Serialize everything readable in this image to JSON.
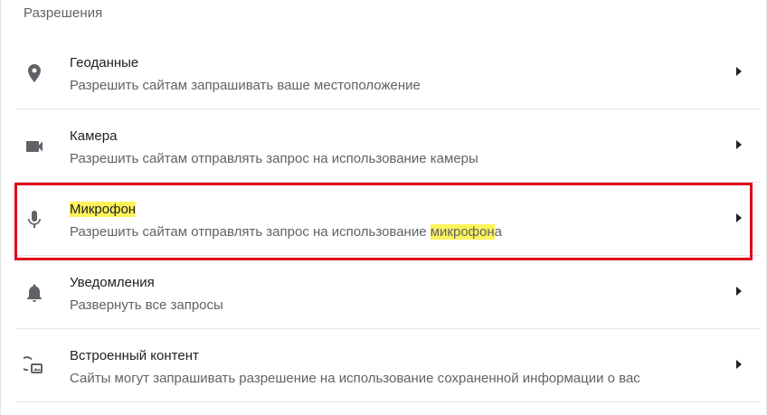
{
  "section": {
    "title": "Разрешения"
  },
  "rows": [
    {
      "icon": "location-pin-icon",
      "title": "Геоданные",
      "desc": "Разрешить сайтам запрашивать ваше местоположение"
    },
    {
      "icon": "videocam-icon",
      "title": "Камера",
      "desc": "Разрешить сайтам отправлять запрос на использование камеры"
    },
    {
      "icon": "microphone-icon",
      "title": "Микрофон",
      "desc_prefix": "Разрешить сайтам отправлять запрос на использование ",
      "desc_highlight": "микрофон",
      "desc_suffix": "а",
      "highlighted": true
    },
    {
      "icon": "bell-icon",
      "title": "Уведомления",
      "desc": "Развернуть все запросы"
    },
    {
      "icon": "embedded-content-icon",
      "title": "Встроенный контент",
      "desc": "Сайты могут запрашивать разрешение на использование сохраненной информации о вас"
    }
  ],
  "colors": {
    "text_primary": "#202124",
    "text_secondary": "#5f6368",
    "icon": "#5f6368",
    "search_highlight": "#fff35c",
    "annotation_box": "#e0001a"
  }
}
